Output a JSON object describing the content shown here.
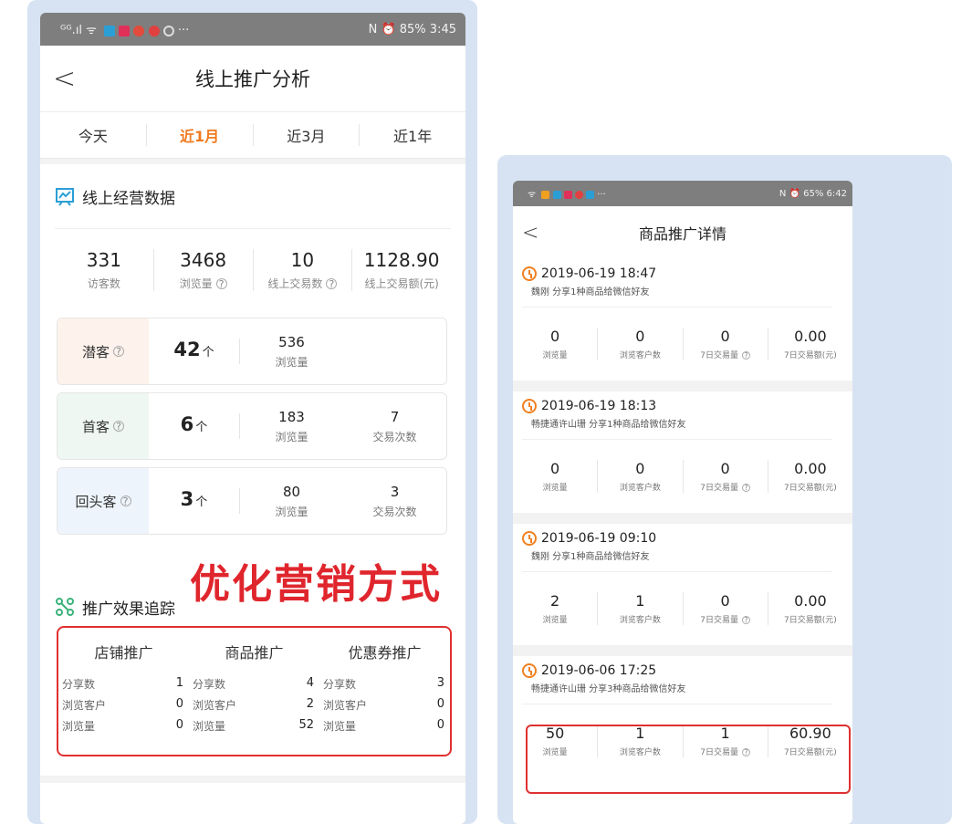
{
  "left": {
    "status": {
      "signals": "ᴳᴳ.ıl ᯤ",
      "right": "N ⏰ 85% 3:45"
    },
    "title": "线上推广分析",
    "back_icon": "chevron-left-icon",
    "periods": [
      "今天",
      "近1月",
      "近3月",
      "近1年"
    ],
    "active_period": "近1月",
    "section1": "线上经营数据",
    "stats": [
      {
        "value": "331",
        "label": "访客数"
      },
      {
        "value": "3468",
        "label": "浏览量"
      },
      {
        "value": "10",
        "label": "线上交易数"
      },
      {
        "value": "1128.90",
        "label": "线上交易额(元)"
      }
    ],
    "customers": [
      {
        "label": "潜客",
        "count": "42",
        "unit": "个",
        "v1": "536",
        "l1": "浏览量",
        "v2": "",
        "l2": "",
        "bg": "#fdf2ec"
      },
      {
        "label": "首客",
        "count": "6",
        "unit": "个",
        "v1": "183",
        "l1": "浏览量",
        "v2": "7",
        "l2": "交易次数",
        "bg": "#eef7f1"
      },
      {
        "label": "回头客",
        "count": "3",
        "unit": "个",
        "v1": "80",
        "l1": "浏览量",
        "v2": "3",
        "l2": "交易次数",
        "bg": "#edf4fb"
      }
    ],
    "overlay": "优化营销方式",
    "section2": "推广效果追踪",
    "promos": [
      {
        "title": "店铺推广",
        "rows": [
          {
            "k": "分享数",
            "v": "1"
          },
          {
            "k": "浏览客户",
            "v": "0"
          },
          {
            "k": "浏览量",
            "v": "0"
          }
        ]
      },
      {
        "title": "商品推广",
        "rows": [
          {
            "k": "分享数",
            "v": "4"
          },
          {
            "k": "浏览客户",
            "v": "2"
          },
          {
            "k": "浏览量",
            "v": "52"
          }
        ]
      },
      {
        "title": "优惠券推广",
        "rows": [
          {
            "k": "分享数",
            "v": "3"
          },
          {
            "k": "浏览客户",
            "v": "0"
          },
          {
            "k": "浏览量",
            "v": "0"
          }
        ]
      }
    ],
    "qm": "?"
  },
  "right": {
    "status": {
      "signals": "ᯤ",
      "right": "N ⏰ 65% 6:42"
    },
    "title": "商品推广详情",
    "entries": [
      {
        "date": "2019-06-19 18:47",
        "sub": "魏刚 分享1种商品给微信好友",
        "m": [
          "0",
          "0",
          "0",
          "0.00"
        ]
      },
      {
        "date": "2019-06-19 18:13",
        "sub": "畅捷通许山珊 分享1种商品给微信好友",
        "m": [
          "0",
          "0",
          "0",
          "0.00"
        ]
      },
      {
        "date": "2019-06-19 09:10",
        "sub": "魏刚 分享1种商品给微信好友",
        "m": [
          "2",
          "1",
          "0",
          "0.00"
        ]
      },
      {
        "date": "2019-06-06 17:25",
        "sub": "畅捷通许山珊 分享3种商品给微信好友",
        "m": [
          "50",
          "1",
          "1",
          "60.90"
        ]
      }
    ],
    "metric_labels": [
      "浏览量",
      "浏览客户数",
      "7日交易量",
      "7日交易额(元)"
    ]
  }
}
